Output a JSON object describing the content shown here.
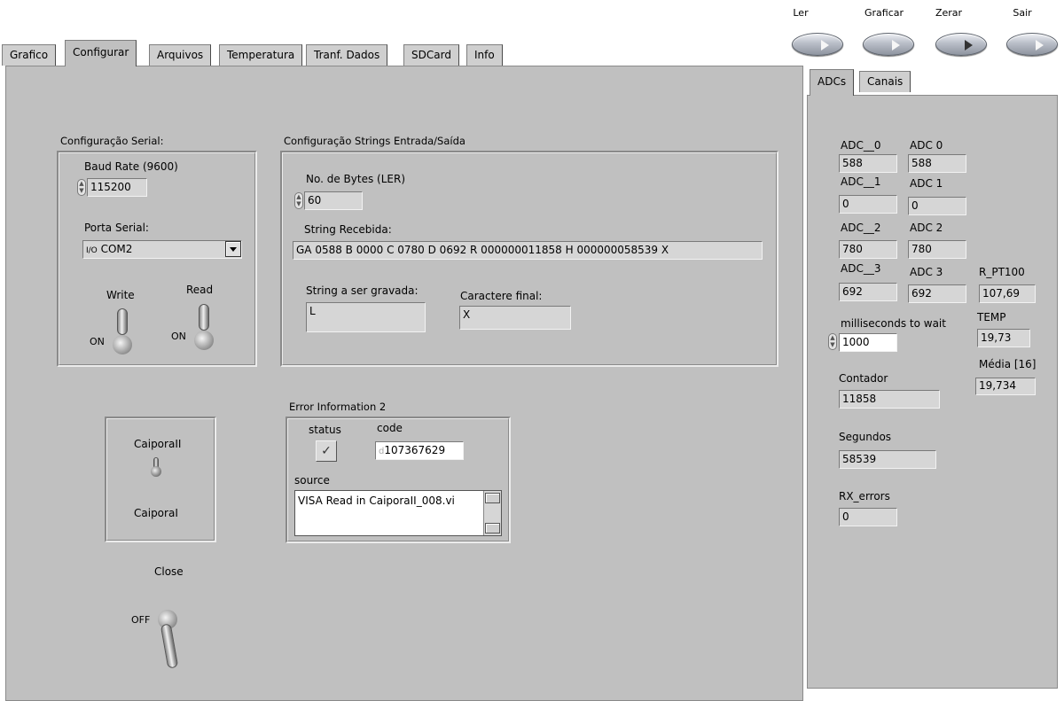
{
  "top_buttons": [
    {
      "label": "Ler"
    },
    {
      "label": "Graficar"
    },
    {
      "label": "Zerar"
    },
    {
      "label": "Sair"
    }
  ],
  "tabs": [
    "Grafico",
    "Configurar",
    "Arquivos",
    "Temperatura",
    "Tranf. Dados",
    "SDCard",
    "Info"
  ],
  "active_tab": "Configurar",
  "serial": {
    "group_label": "Configuração Serial:",
    "baud_label": "Baud Rate (9600)",
    "baud_value": "115200",
    "port_label": "Porta Serial:",
    "port_prefix": "I/O",
    "port_value": "COM2",
    "write_label": "Write",
    "read_label": "Read",
    "write_state": "ON",
    "read_state": "ON"
  },
  "strings_io": {
    "group_label": "Configuração Strings Entrada/Saída",
    "bytes_label": "No. de Bytes (LER)",
    "bytes_value": "60",
    "received_label": "String Recebida:",
    "received_value": "GA 0588 B 0000 C 0780 D 0692 R 000000011858 H 000000058539 X",
    "write_string_label": "String a ser gravada:",
    "write_string_value": "L",
    "final_char_label": "Caractere final:",
    "final_char_value": "X"
  },
  "selector": {
    "top_label": "CaiporaII",
    "bottom_label": "CaiporaI"
  },
  "close": {
    "label": "Close",
    "state": "OFF"
  },
  "error": {
    "group_label": "Error Information 2",
    "status_label": "status",
    "code_label": "code",
    "code_prefix": "d",
    "code_value": "107367629",
    "source_label": "source",
    "source_value": "VISA Read in CaiporaII_008.vi"
  },
  "side_tabs": [
    "ADCs",
    "Canais"
  ],
  "adcs": {
    "left": [
      {
        "label": "ADC__0",
        "value": "588"
      },
      {
        "label": "ADC__1",
        "value": "0"
      },
      {
        "label": "ADC__2",
        "value": "780"
      },
      {
        "label": "ADC__3",
        "value": "692"
      }
    ],
    "right": [
      {
        "label": "ADC 0",
        "value": "588"
      },
      {
        "label": "ADC 1",
        "value": "0"
      },
      {
        "label": "ADC 2",
        "value": "780"
      },
      {
        "label": "ADC 3",
        "value": "692"
      }
    ],
    "rpt100_label": "R_PT100",
    "rpt100_value": "107,69",
    "temp_label": "TEMP",
    "temp_value": "19,73",
    "media_label": "Média [16]",
    "media_value": "19,734",
    "wait_label": "milliseconds to wait",
    "wait_value": "1000",
    "contador_label": "Contador",
    "contador_value": "11858",
    "segundos_label": "Segundos",
    "segundos_value": "58539",
    "rx_label": "RX_errors",
    "rx_value": "0"
  }
}
